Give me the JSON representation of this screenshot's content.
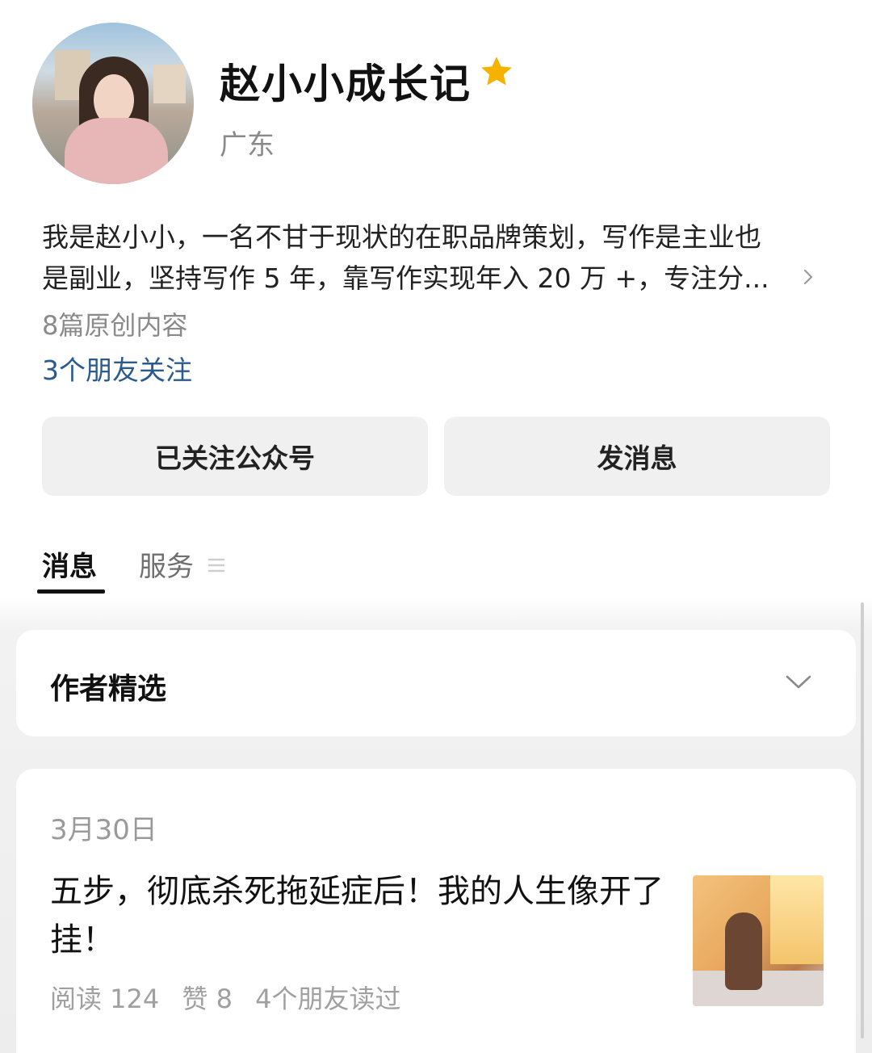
{
  "profile": {
    "name": "赵小小成长记",
    "region": "广东",
    "bio_line1": "我是赵小小，一名不甘于现状的在职品牌策划，写作是主业也",
    "bio_line2": "是副业，坚持写作 5 年，靠写作实现年入 20 万 +，专注分...",
    "original_count": "8篇原创内容",
    "friends_following": "3个朋友关注",
    "star_color": "#f5b300"
  },
  "actions": {
    "follow_label": "已关注公众号",
    "message_label": "发消息"
  },
  "tabs": [
    {
      "label": "消息",
      "active": true
    },
    {
      "label": "服务",
      "active": false
    }
  ],
  "featured": {
    "title": "作者精选"
  },
  "article": {
    "date": "3月30日",
    "title": "五步，彻底杀死拖延症后！我的人生像开了挂！",
    "reads": "阅读 124",
    "likes": "赞 8",
    "friends_read": "4个朋友读过"
  },
  "icons": [
    "star-icon",
    "chevron-right-icon",
    "menu-icon",
    "chevron-down-icon"
  ]
}
